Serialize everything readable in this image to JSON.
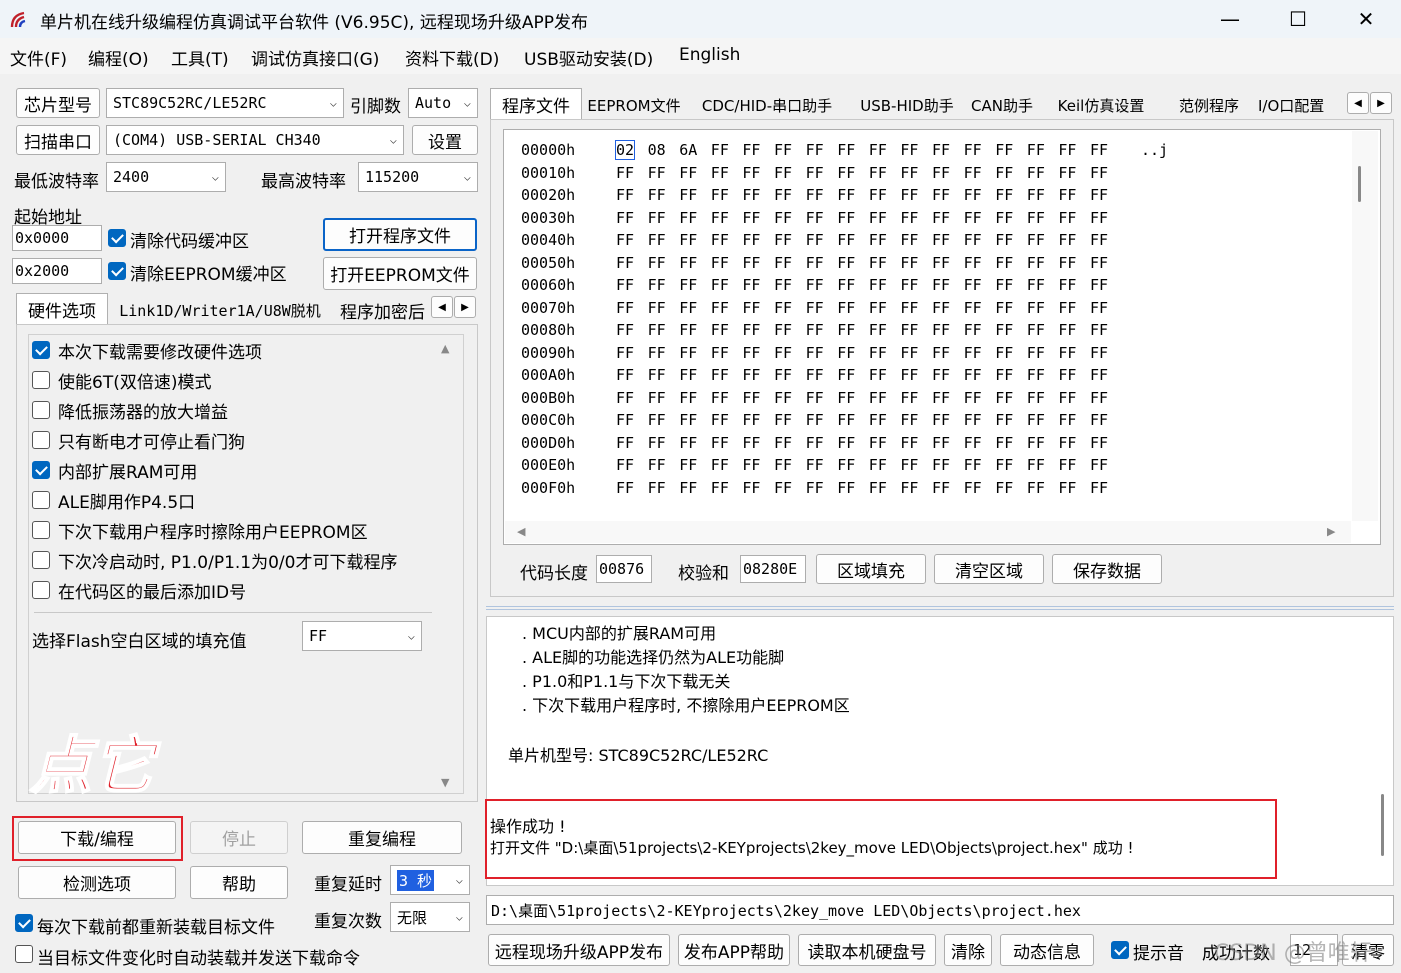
{
  "window": {
    "title": "单片机在线升级编程仿真调试平台软件 (V6.95C), 远程现场升级APP发布",
    "minimize": "—",
    "maximize": "☐",
    "close": "✕"
  },
  "menu": [
    "文件(F)",
    "编程(O)",
    "工具(T)",
    "调试仿真接口(G)",
    "资料下载(D)",
    "USB驱动安装(D)",
    "English"
  ],
  "left": {
    "chip_label": "芯片型号",
    "chip_value": "STC89C52RC/LE52RC",
    "pin_label": "引脚数",
    "pin_value": "Auto",
    "scan_button": "扫描串口",
    "port_value": "(COM4) USB-SERIAL CH340",
    "settings_button": "设置",
    "min_baud_label": "最低波特率",
    "min_baud_value": "2400",
    "max_baud_label": "最高波特率",
    "max_baud_value": "115200",
    "start_addr_label": "起始地址",
    "addr1": "0x0000",
    "clear_code_label": "清除代码缓冲区",
    "open_program_button": "打开程序文件",
    "addr2": "0x2000",
    "clear_eeprom_label": "清除EEPROM缓冲区",
    "open_eeprom_button": "打开EEPROM文件",
    "tabs": [
      "硬件选项",
      "Link1D/Writer1A/U8W脱机",
      "程序加密后"
    ],
    "options": [
      {
        "label": "本次下载需要修改硬件选项",
        "checked": true
      },
      {
        "label": "使能6T(双倍速)模式",
        "checked": false
      },
      {
        "label": "降低振荡器的放大增益",
        "checked": false
      },
      {
        "label": "只有断电才可停止看门狗",
        "checked": false
      },
      {
        "label": "内部扩展RAM可用",
        "checked": true
      },
      {
        "label": "ALE脚用作P4.5口",
        "checked": false
      },
      {
        "label": "下次下载用户程序时擦除用户EEPROM区",
        "checked": false
      },
      {
        "label": "下次冷启动时, P1.0/P1.1为0/0才可下载程序",
        "checked": false
      },
      {
        "label": "在代码区的最后添加ID号",
        "checked": false
      }
    ],
    "fill_label": "选择Flash空白区域的填充值",
    "fill_value": "FF",
    "annotation": "点它",
    "download_button": "下载/编程",
    "stop_button": "停止",
    "reprogram_button": "重复编程",
    "check_button": "检测选项",
    "help_button": "帮助",
    "repeat_delay_label": "重复延时",
    "repeat_delay_value": "3 秒",
    "repeat_count_label": "重复次数",
    "repeat_count_value": "无限",
    "reload_label": "每次下载前都重新装载目标文件",
    "autoload_label": "当目标文件变化时自动装载并发送下载命令"
  },
  "right": {
    "tabs": [
      "程序文件",
      "EEPROM文件",
      "CDC/HID-串口助手",
      "USB-HID助手",
      "CAN助手",
      "Keil仿真设置",
      "范例程序",
      "I/O口配置"
    ],
    "hex_rows": [
      {
        "addr": "00000h",
        "bytes": [
          "02",
          "08",
          "6A",
          "FF",
          "FF",
          "FF",
          "FF",
          "FF",
          "FF",
          "FF",
          "FF",
          "FF",
          "FF",
          "FF",
          "FF",
          "FF"
        ],
        "ascii": "..j"
      },
      {
        "addr": "00010h",
        "bytes": [
          "FF",
          "FF",
          "FF",
          "FF",
          "FF",
          "FF",
          "FF",
          "FF",
          "FF",
          "FF",
          "FF",
          "FF",
          "FF",
          "FF",
          "FF",
          "FF"
        ],
        "ascii": ""
      },
      {
        "addr": "00020h",
        "bytes": [
          "FF",
          "FF",
          "FF",
          "FF",
          "FF",
          "FF",
          "FF",
          "FF",
          "FF",
          "FF",
          "FF",
          "FF",
          "FF",
          "FF",
          "FF",
          "FF"
        ],
        "ascii": ""
      },
      {
        "addr": "00030h",
        "bytes": [
          "FF",
          "FF",
          "FF",
          "FF",
          "FF",
          "FF",
          "FF",
          "FF",
          "FF",
          "FF",
          "FF",
          "FF",
          "FF",
          "FF",
          "FF",
          "FF"
        ],
        "ascii": ""
      },
      {
        "addr": "00040h",
        "bytes": [
          "FF",
          "FF",
          "FF",
          "FF",
          "FF",
          "FF",
          "FF",
          "FF",
          "FF",
          "FF",
          "FF",
          "FF",
          "FF",
          "FF",
          "FF",
          "FF"
        ],
        "ascii": ""
      },
      {
        "addr": "00050h",
        "bytes": [
          "FF",
          "FF",
          "FF",
          "FF",
          "FF",
          "FF",
          "FF",
          "FF",
          "FF",
          "FF",
          "FF",
          "FF",
          "FF",
          "FF",
          "FF",
          "FF"
        ],
        "ascii": ""
      },
      {
        "addr": "00060h",
        "bytes": [
          "FF",
          "FF",
          "FF",
          "FF",
          "FF",
          "FF",
          "FF",
          "FF",
          "FF",
          "FF",
          "FF",
          "FF",
          "FF",
          "FF",
          "FF",
          "FF"
        ],
        "ascii": ""
      },
      {
        "addr": "00070h",
        "bytes": [
          "FF",
          "FF",
          "FF",
          "FF",
          "FF",
          "FF",
          "FF",
          "FF",
          "FF",
          "FF",
          "FF",
          "FF",
          "FF",
          "FF",
          "FF",
          "FF"
        ],
        "ascii": ""
      },
      {
        "addr": "00080h",
        "bytes": [
          "FF",
          "FF",
          "FF",
          "FF",
          "FF",
          "FF",
          "FF",
          "FF",
          "FF",
          "FF",
          "FF",
          "FF",
          "FF",
          "FF",
          "FF",
          "FF"
        ],
        "ascii": ""
      },
      {
        "addr": "00090h",
        "bytes": [
          "FF",
          "FF",
          "FF",
          "FF",
          "FF",
          "FF",
          "FF",
          "FF",
          "FF",
          "FF",
          "FF",
          "FF",
          "FF",
          "FF",
          "FF",
          "FF"
        ],
        "ascii": ""
      },
      {
        "addr": "000A0h",
        "bytes": [
          "FF",
          "FF",
          "FF",
          "FF",
          "FF",
          "FF",
          "FF",
          "FF",
          "FF",
          "FF",
          "FF",
          "FF",
          "FF",
          "FF",
          "FF",
          "FF"
        ],
        "ascii": ""
      },
      {
        "addr": "000B0h",
        "bytes": [
          "FF",
          "FF",
          "FF",
          "FF",
          "FF",
          "FF",
          "FF",
          "FF",
          "FF",
          "FF",
          "FF",
          "FF",
          "FF",
          "FF",
          "FF",
          "FF"
        ],
        "ascii": ""
      },
      {
        "addr": "000C0h",
        "bytes": [
          "FF",
          "FF",
          "FF",
          "FF",
          "FF",
          "FF",
          "FF",
          "FF",
          "FF",
          "FF",
          "FF",
          "FF",
          "FF",
          "FF",
          "FF",
          "FF"
        ],
        "ascii": ""
      },
      {
        "addr": "000D0h",
        "bytes": [
          "FF",
          "FF",
          "FF",
          "FF",
          "FF",
          "FF",
          "FF",
          "FF",
          "FF",
          "FF",
          "FF",
          "FF",
          "FF",
          "FF",
          "FF",
          "FF"
        ],
        "ascii": ""
      },
      {
        "addr": "000E0h",
        "bytes": [
          "FF",
          "FF",
          "FF",
          "FF",
          "FF",
          "FF",
          "FF",
          "FF",
          "FF",
          "FF",
          "FF",
          "FF",
          "FF",
          "FF",
          "FF",
          "FF"
        ],
        "ascii": ""
      },
      {
        "addr": "000F0h",
        "bytes": [
          "FF",
          "FF",
          "FF",
          "FF",
          "FF",
          "FF",
          "FF",
          "FF",
          "FF",
          "FF",
          "FF",
          "FF",
          "FF",
          "FF",
          "FF",
          "FF"
        ],
        "ascii": ""
      }
    ],
    "code_len_label": "代码长度",
    "code_len_value": "00876",
    "checksum_label": "校验和",
    "checksum_value": "08280E",
    "fill_area_button": "区域填充",
    "clear_area_button": "清空区域",
    "save_data_button": "保存数据",
    "log_lines": [
      ". MCU内部的扩展RAM可用",
      ". ALE脚的功能选择仍然为ALE功能脚",
      ". P1.0和P1.1与下次下载无关",
      ". 下次下载用户程序时, 不擦除用户EEPROM区",
      "",
      "单片机型号: STC89C52RC/LE52RC"
    ],
    "result_line1": "操作成功 !",
    "result_line2": "打开文件 \"D:\\桌面\\51projects\\2-KEYprojects\\2key_move LED\\Objects\\project.hex\" 成功 !",
    "path": "D:\\桌面\\51projects\\2-KEYprojects\\2key_move LED\\Objects\\project.hex",
    "bottom_buttons": [
      "远程现场升级APP发布",
      "发布APP帮助",
      "读取本机硬盘号",
      "清除",
      "动态信息"
    ],
    "beep_label": "提示音",
    "success_count_label": "成功计数",
    "success_count_value": "12",
    "clear_button": "清零",
    "watermark": "CSDN @曾唯轩"
  },
  "colors": {
    "accent": "#0067c0",
    "annotation_red": "#e0202a",
    "selection_blue": "#2060e0"
  }
}
